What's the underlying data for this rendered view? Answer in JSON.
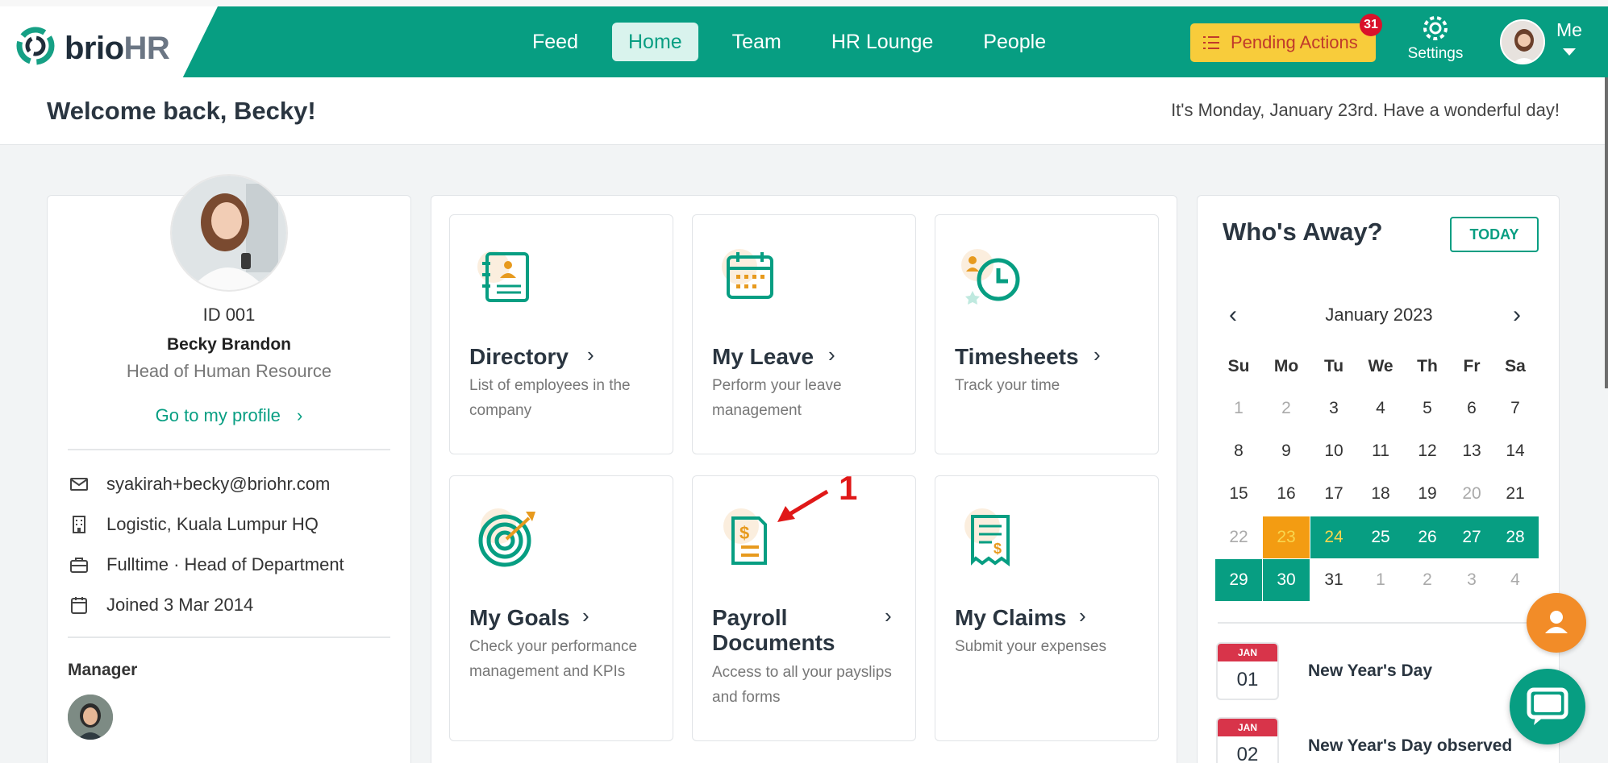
{
  "brand": {
    "part1": "brio",
    "part2": "HR"
  },
  "nav": [
    {
      "label": "Feed"
    },
    {
      "label": "Home"
    },
    {
      "label": "Team"
    },
    {
      "label": "HR Lounge"
    },
    {
      "label": "People"
    }
  ],
  "pending": {
    "label": "Pending Actions",
    "count": "31"
  },
  "settings": {
    "label": "Settings"
  },
  "me": {
    "label": "Me"
  },
  "welcome": {
    "title": "Welcome back, Becky!",
    "date_text": "It's Monday, January 23rd. Have a wonderful day!"
  },
  "profile": {
    "id": "ID 001",
    "name": "Becky Brandon",
    "role": "Head of Human Resource",
    "link": "Go to my profile",
    "email": "syakirah+becky@briohr.com",
    "location": "Logistic, Kuala Lumpur HQ",
    "employment": "Fulltime · Head of Department",
    "joined": "Joined 3 Mar 2014",
    "manager_label": "Manager"
  },
  "tiles": [
    {
      "title": "Directory",
      "desc": "List of employees in the company"
    },
    {
      "title": "My Leave",
      "desc": "Perform your leave management"
    },
    {
      "title": "Timesheets",
      "desc": "Track your time"
    },
    {
      "title": "My Goals",
      "desc": "Check your performance management and KPIs"
    },
    {
      "title": "Payroll Documents",
      "desc": "Access to all your payslips and forms"
    },
    {
      "title": "My Claims",
      "desc": "Submit your expenses"
    }
  ],
  "annotation": {
    "number": "1"
  },
  "away": {
    "title": "Who's Away?",
    "today_btn": "TODAY",
    "month": "January 2023",
    "weekdays": [
      "Su",
      "Mo",
      "Tu",
      "We",
      "Th",
      "Fr",
      "Sa"
    ],
    "weeks": [
      [
        "1",
        "2",
        "3",
        "4",
        "5",
        "6",
        "7"
      ],
      [
        "8",
        "9",
        "10",
        "11",
        "12",
        "13",
        "14"
      ],
      [
        "15",
        "16",
        "17",
        "18",
        "19",
        "20",
        "21"
      ],
      [
        "22",
        "23",
        "24",
        "25",
        "26",
        "27",
        "28"
      ],
      [
        "29",
        "30",
        "31",
        "1",
        "2",
        "3",
        "4"
      ]
    ],
    "holidays": [
      {
        "month": "JAN",
        "day": "01",
        "name": "New Year's Day"
      },
      {
        "month": "JAN",
        "day": "02",
        "name": "New Year's Day observed"
      }
    ]
  },
  "colors": {
    "primary": "#079e82",
    "pending": "#f8cc3b",
    "today": "#f39c12",
    "badge": "#d9112b",
    "fab": "#f28c28"
  }
}
